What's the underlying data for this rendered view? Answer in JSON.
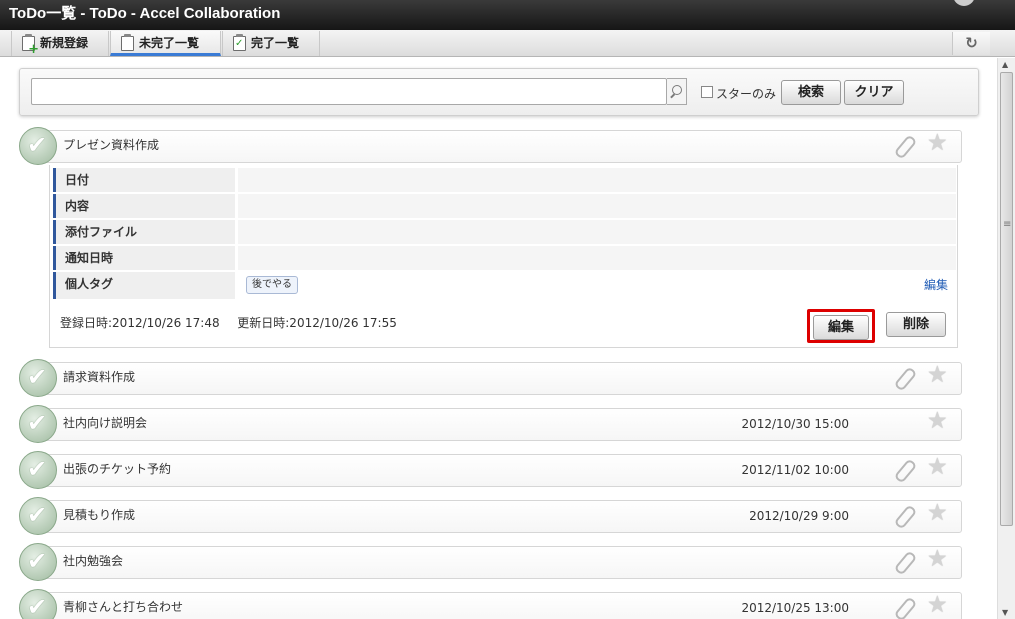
{
  "window": {
    "title": "ToDo一覧 - ToDo - Accel Collaboration"
  },
  "tabs": [
    {
      "label": "新規登録",
      "icon": "clipboard-plus-icon"
    },
    {
      "label": "未完了一覧",
      "icon": "clipboard-icon",
      "active": true
    },
    {
      "label": "完了一覧",
      "icon": "clipboard-check-icon"
    }
  ],
  "refresh": {
    "glyph": "↻"
  },
  "search": {
    "value": "",
    "placeholder": "",
    "star_only_label": "スターのみ",
    "star_only_checked": false,
    "search_label": "検索",
    "clear_label": "クリア"
  },
  "expanded_item": {
    "title": "プレゼン資料作成",
    "fields": [
      {
        "label": "日付",
        "value": ""
      },
      {
        "label": "内容",
        "value": ""
      },
      {
        "label": "添付ファイル",
        "value": ""
      },
      {
        "label": "通知日時",
        "value": ""
      },
      {
        "label": "個人タグ",
        "tag": "後でやる",
        "edit_link": "編集"
      }
    ],
    "registered": "登録日時:2012/10/26 17:48",
    "updated": "更新日時:2012/10/26 17:55",
    "edit_label": "編集",
    "delete_label": "削除"
  },
  "items": [
    {
      "title": "請求資料作成",
      "date": "",
      "attachment": true
    },
    {
      "title": "社内向け説明会",
      "date": "2012/10/30 15:00",
      "attachment": false
    },
    {
      "title": "出張のチケット予約",
      "date": "2012/11/02 10:00",
      "attachment": true
    },
    {
      "title": "見積もり作成",
      "date": "2012/10/29 9:00",
      "attachment": true
    },
    {
      "title": "社内勉強会",
      "date": "",
      "attachment": true
    },
    {
      "title": "青柳さんと打ち合わせ",
      "date": "2012/10/25 13:00",
      "attachment": true
    }
  ],
  "colors": {
    "title_bar": "#1f1f1f",
    "active_tab_underline": "#3a7bd5",
    "label_accent": "#30579c",
    "highlight": "#dd0000",
    "link": "#1f5bb5"
  },
  "glyphs": {
    "star": "★"
  }
}
